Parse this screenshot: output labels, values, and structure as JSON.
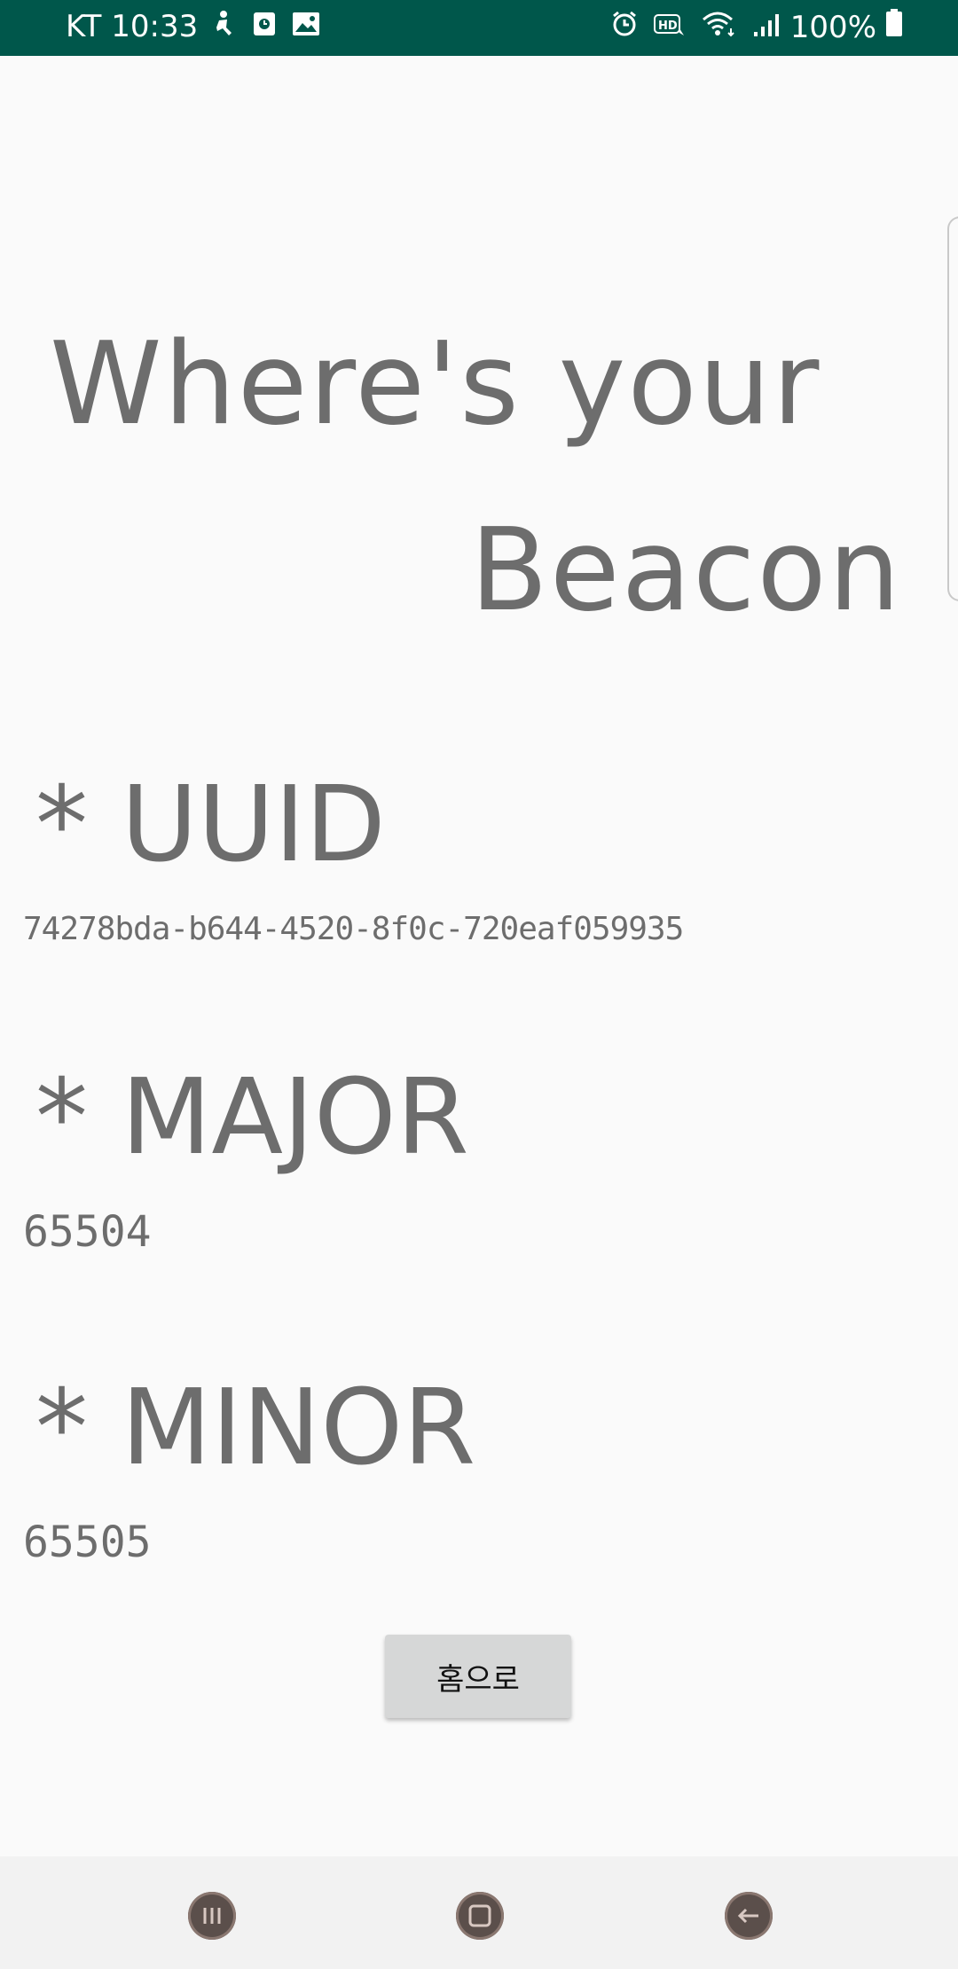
{
  "status_bar": {
    "carrier_time": "KT 10:33",
    "battery_percent": "100%",
    "icons_left": [
      "accessibility-icon",
      "clock-app-icon",
      "gallery-icon"
    ],
    "icons_right": [
      "alarm-icon",
      "hd-icon",
      "wifi-icon",
      "signal-icon",
      "battery-icon"
    ],
    "background_color": "#00574b"
  },
  "main": {
    "title_line1": "Where's your",
    "title_line2": "Beacon",
    "uuid_label": "* UUID",
    "uuid_value": "74278bda-b644-4520-8f0c-720eaf059935",
    "major_label": "* MAJOR",
    "major_value": "65504",
    "minor_label": "* MINOR",
    "minor_value": "65505",
    "home_button_label": "홈으로",
    "text_color": "#6d6d6d"
  },
  "nav_bar": {
    "buttons": [
      "recent-apps-icon",
      "home-icon",
      "back-icon"
    ]
  }
}
